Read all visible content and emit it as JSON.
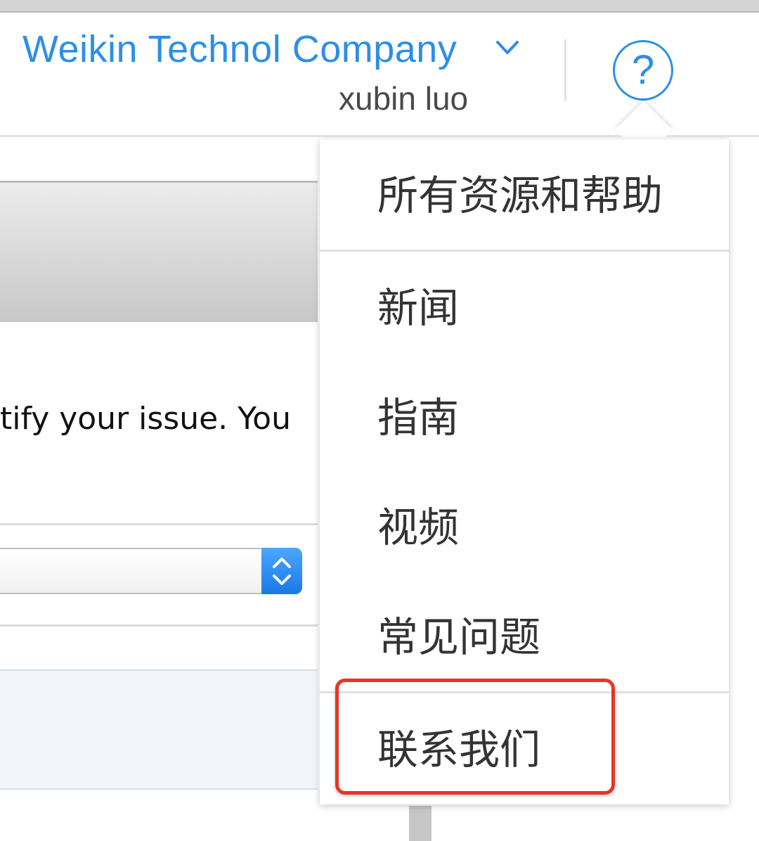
{
  "header": {
    "company_name": "Weikin Technol Company",
    "user_name": "xubin luo",
    "help_symbol": "?"
  },
  "main": {
    "issue_text": "tify your issue. You"
  },
  "help_menu": {
    "items": [
      {
        "label": "所有资源和帮助"
      },
      {
        "label": "新闻"
      },
      {
        "label": "指南"
      },
      {
        "label": "视频"
      },
      {
        "label": "常见问题"
      },
      {
        "label": "联系我们"
      }
    ]
  },
  "colors": {
    "accent": "#2b8fe8",
    "highlight": "#e53527"
  },
  "icons": [
    "chevron-down-icon",
    "help-question-icon",
    "select-stepper-icon"
  ]
}
